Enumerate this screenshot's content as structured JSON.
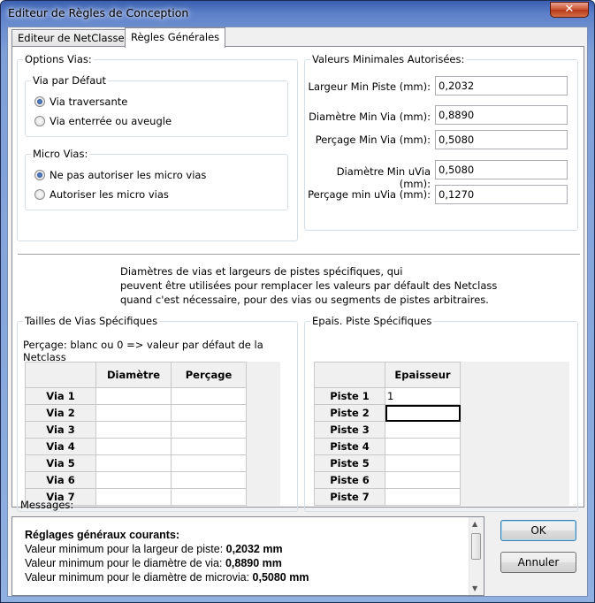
{
  "window": {
    "title": "Editeur de Règles de Conception",
    "close_symbol": "✕"
  },
  "tabs": [
    {
      "label": "Editeur de NetClasses"
    },
    {
      "label": "Règles Générales"
    }
  ],
  "via_options": {
    "group_label": "Options Vias:",
    "default_via": {
      "label": "Via par Défaut",
      "options": [
        "Via traversante",
        "Via enterrée ou aveugle"
      ],
      "selected": 0
    },
    "micro_vias": {
      "label": "Micro Vias:",
      "options": [
        "Ne pas autoriser les micro vias",
        "Autoriser les micro vias"
      ],
      "selected": 0
    }
  },
  "min_values": {
    "group_label": "Valeurs Minimales Autorisées:",
    "fields": [
      {
        "label": "Largeur Min Piste (mm):",
        "value": "0,2032"
      },
      {
        "label": "Diamètre Min Via (mm):",
        "value": "0,8890"
      },
      {
        "label": "Perçage Min Via (mm):",
        "value": "0,5080"
      },
      {
        "label": "Diamètre Min uVia (mm):",
        "value": "0,5080"
      },
      {
        "label": "Perçage min uVia (mm):",
        "value": "0,1270"
      }
    ]
  },
  "info_lines": [
    "Diamètres de vias et largeurs de pistes spécifiques, qui",
    "peuvent être utilisées pour remplacer les valeurs par défault des Netclass",
    "quand c'est nécessaire, pour des vias ou segments de pistes arbitraires."
  ],
  "via_sizes": {
    "group_label": "Tailles de Vias Spécifiques",
    "hint": "Perçage: blanc ou 0 => valeur par défaut de la Netclass",
    "columns": [
      "Diamètre",
      "Perçage"
    ],
    "rows": [
      {
        "label": "Via 1",
        "cells": [
          "",
          ""
        ]
      },
      {
        "label": "Via 2",
        "cells": [
          "",
          ""
        ]
      },
      {
        "label": "Via 3",
        "cells": [
          "",
          ""
        ]
      },
      {
        "label": "Via 4",
        "cells": [
          "",
          ""
        ]
      },
      {
        "label": "Via 5",
        "cells": [
          "",
          ""
        ]
      },
      {
        "label": "Via 6",
        "cells": [
          "",
          ""
        ]
      },
      {
        "label": "Via 7",
        "cells": [
          "",
          ""
        ]
      }
    ]
  },
  "track_widths": {
    "group_label": "Epais. Piste Spécifiques",
    "columns": [
      "Epaisseur"
    ],
    "rows": [
      {
        "label": "Piste 1",
        "cells": [
          "1"
        ]
      },
      {
        "label": "Piste 2",
        "cells": [
          ""
        ]
      },
      {
        "label": "Piste 3",
        "cells": [
          ""
        ]
      },
      {
        "label": "Piste 4",
        "cells": [
          ""
        ]
      },
      {
        "label": "Piste 5",
        "cells": [
          ""
        ]
      },
      {
        "label": "Piste 6",
        "cells": [
          ""
        ]
      },
      {
        "label": "Piste 7",
        "cells": [
          ""
        ]
      }
    ]
  },
  "messages": {
    "label": "Messages:",
    "heading": "Réglages généraux courants:",
    "lines": [
      {
        "text": "Valeur minimum pour la largeur de piste: ",
        "value": "0,2032 mm"
      },
      {
        "text": "Valeur minimum pour le diamètre de via: ",
        "value": "0,8890 mm"
      },
      {
        "text": "Valeur minimum pour le diamètre de microvia: ",
        "value": "0,5080 mm"
      }
    ]
  },
  "buttons": {
    "ok": "OK",
    "cancel": "Annuler"
  }
}
